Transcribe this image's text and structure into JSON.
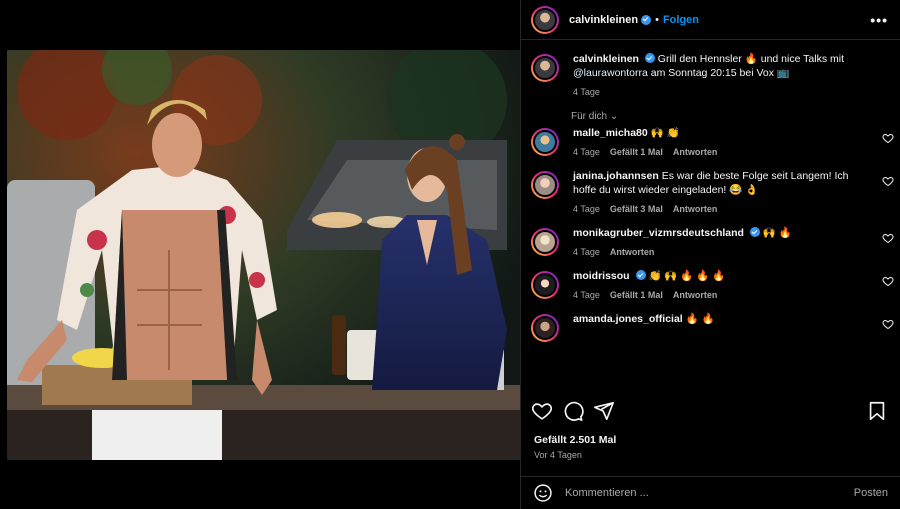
{
  "post": {
    "author": "calvinkleinen",
    "follow_label": "Folgen",
    "dot": "•",
    "more": "•••",
    "caption_pre": " Grill den Hennsler ",
    "caption_fire": "🔥",
    "caption_mid": " und nice Talks mit ",
    "caption_mention": "@laurawontorra",
    "caption_post": " am Sonntag 20:15 bei Vox ",
    "caption_tv": "📺",
    "caption_age": "4 Tage",
    "for_you": "Für dich ⌄",
    "likes": "Gefällt 2.501 Mal",
    "date": "Vor 4 Tagen",
    "comment_placeholder": "Kommentieren ...",
    "post_label": "Posten"
  },
  "comments": [
    {
      "user": "malle_micha80",
      "verified": false,
      "text": "🙌 👏",
      "time": "4 Tage",
      "likes": "Gefällt 1 Mal",
      "reply": "Antworten"
    },
    {
      "user": "janina.johannsen",
      "verified": false,
      "text": "Es war die beste Folge seit Langem! Ich hoffe du wirst wieder eingeladen! 😂 👌",
      "time": "4 Tage",
      "likes": "Gefällt 3 Mal",
      "reply": "Antworten"
    },
    {
      "user": "monikagruber_vizmrsdeutschland",
      "verified": true,
      "text": "🙌 🔥",
      "time": "4 Tage",
      "likes": "",
      "reply": "Antworten"
    },
    {
      "user": "moidrissou",
      "verified": true,
      "text": "👏 🙌 🔥 🔥 🔥",
      "time": "4 Tage",
      "likes": "Gefällt 1 Mal",
      "reply": "Antworten"
    },
    {
      "user": "amanda.jones_official",
      "verified": false,
      "text": "🔥 🔥",
      "time": "",
      "likes": "",
      "reply": ""
    }
  ]
}
